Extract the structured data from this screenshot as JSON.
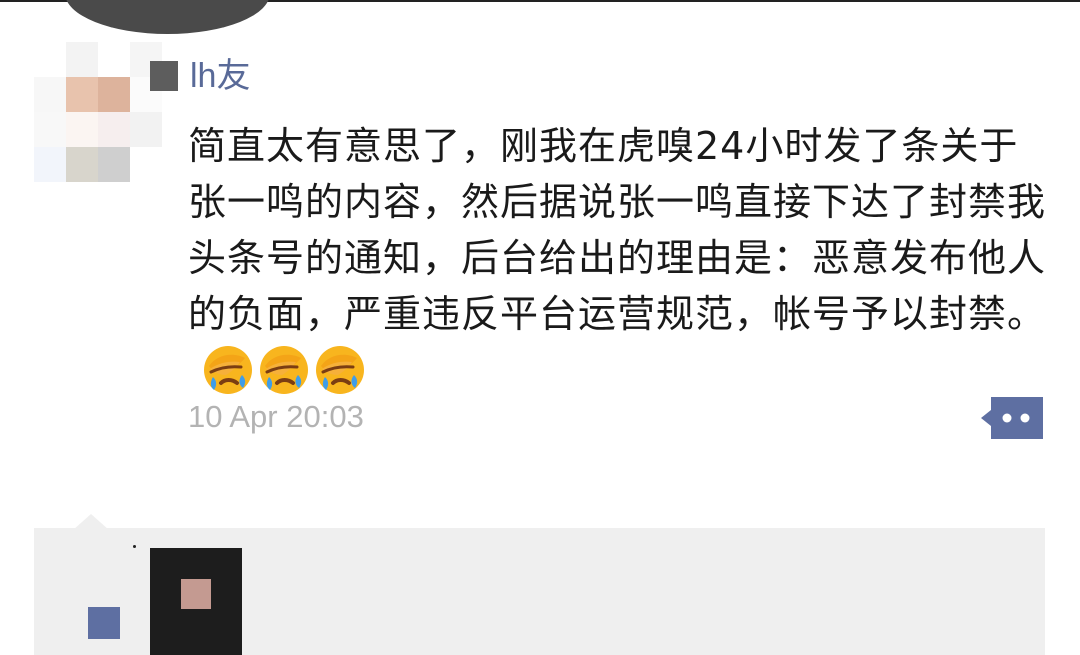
{
  "post": {
    "username": "lh友",
    "text": "简直太有意思了，刚我在虎嗅24小时发了条关于张一鸣的内容，然后据说张一鸣直接下达了封禁我头条号的通知，后台给出的理由是：恶意发布他人的负面，严重违反平台运营规范，帐号予以封禁。",
    "emojis": [
      "facepalm-icon",
      "facepalm-icon",
      "facepalm-icon"
    ],
    "timestamp": "10 Apr 20:03"
  },
  "actions": {
    "comment_icon": "comment-more-icon"
  },
  "colors": {
    "username": "#596a98",
    "body_text": "#1a1a1a",
    "timestamp": "#b3b3b3",
    "comment_panel": "#efefef",
    "comment_icon": "#5e6fa2"
  }
}
